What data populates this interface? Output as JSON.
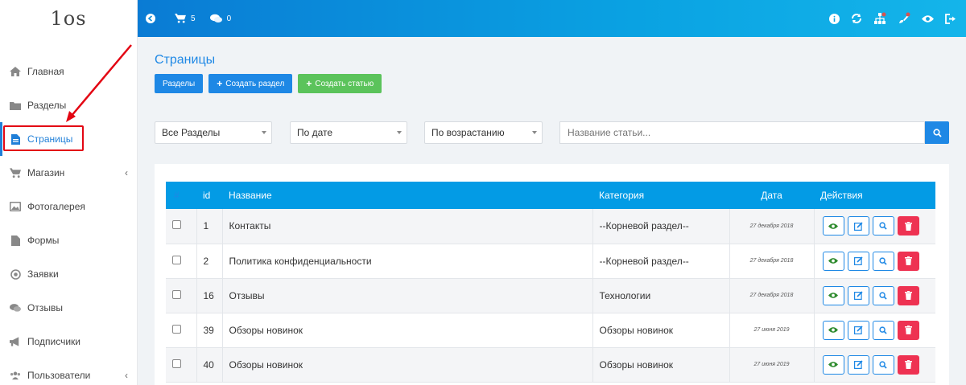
{
  "logo": {
    "text": "1os"
  },
  "sidebar": {
    "items": [
      {
        "label": "Главная",
        "icon": "home-icon",
        "active": false,
        "chevron": false
      },
      {
        "label": "Разделы",
        "icon": "folder-icon",
        "active": false,
        "chevron": false
      },
      {
        "label": "Страницы",
        "icon": "file-icon",
        "active": true,
        "chevron": false
      },
      {
        "label": "Магазин",
        "icon": "cart-icon",
        "active": false,
        "chevron": true
      },
      {
        "label": "Фотогалерея",
        "icon": "image-icon",
        "active": false,
        "chevron": false
      },
      {
        "label": "Формы",
        "icon": "document-icon",
        "active": false,
        "chevron": false
      },
      {
        "label": "Заявки",
        "icon": "circle-dot-icon",
        "active": false,
        "chevron": false
      },
      {
        "label": "Отзывы",
        "icon": "comments-icon",
        "active": false,
        "chevron": false
      },
      {
        "label": "Подписчики",
        "icon": "bullhorn-icon",
        "active": false,
        "chevron": false
      },
      {
        "label": "Пользователи",
        "icon": "users-icon",
        "active": false,
        "chevron": true
      }
    ],
    "chevron": "‹"
  },
  "topbar": {
    "cart_count": "5",
    "messages_count": "0",
    "right_icons": [
      "info-icon",
      "refresh-icon",
      "sitemap-icon",
      "brush-icon",
      "eye-icon",
      "logout-icon"
    ]
  },
  "main": {
    "title": "Страницы",
    "buttons": {
      "sections": "Разделы",
      "create_section": "Создать раздел",
      "create_article": "Создать статью"
    },
    "filters": {
      "section": "Все Разделы",
      "sort_by": "По дате",
      "order": "По возрастанию"
    },
    "search": {
      "placeholder": "Название статьи..."
    }
  },
  "table": {
    "headers": {
      "check": "#",
      "id": "id",
      "name": "Название",
      "category": "Категория",
      "date": "Дата",
      "actions": "Действия"
    },
    "rows": [
      {
        "id": "1",
        "name": "Контакты",
        "category": "--Корневой раздел--",
        "date": "27 декабря 2018"
      },
      {
        "id": "2",
        "name": "Политика конфиденциальности",
        "category": "--Корневой раздел--",
        "date": "27 декабря 2018"
      },
      {
        "id": "16",
        "name": "Отзывы",
        "category": "Технологии",
        "date": "27 декабря 2018"
      },
      {
        "id": "39",
        "name": "Обзоры новинок",
        "category": "Обзоры новинок",
        "date": "27 июня 2019"
      },
      {
        "id": "40",
        "name": "Обзоры новинок",
        "category": "Обзоры новинок",
        "date": "27 июня 2019"
      }
    ]
  },
  "colors": {
    "primary": "#1e88e5",
    "header": "#039be5",
    "success": "#5bc35b",
    "danger": "#ee3252",
    "highlight": "#e30613"
  }
}
